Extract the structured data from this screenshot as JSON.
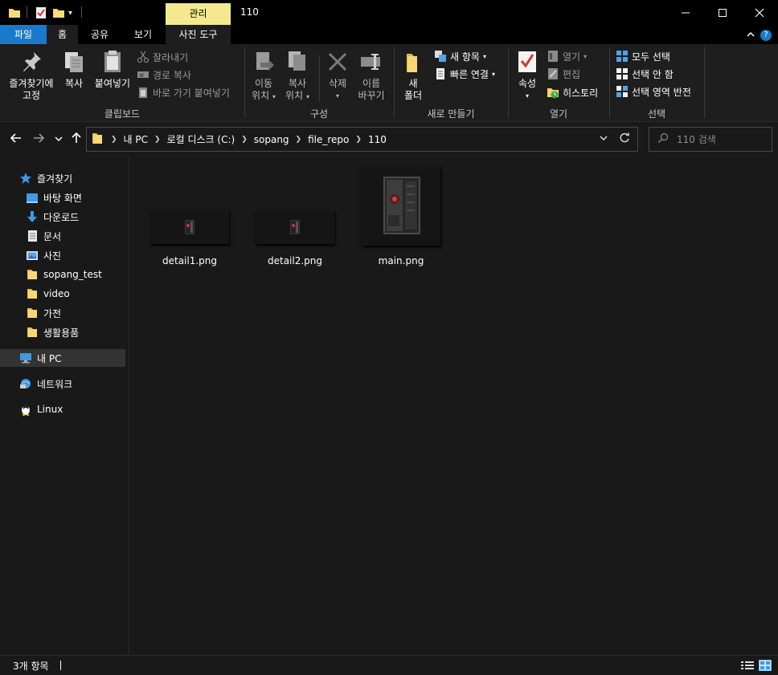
{
  "titlebar": {
    "manage_tab": "관리",
    "title": "110",
    "minimize_icon": "minimize-icon",
    "maximize_icon": "maximize-icon",
    "close_icon": "close-icon"
  },
  "ribbon_tabs": {
    "file": "파일",
    "home": "홈",
    "share": "공유",
    "view": "보기",
    "picture_tools": "사진 도구",
    "help": "?"
  },
  "ribbon": {
    "clipboard": {
      "label": "클립보드",
      "pin_line1": "즐겨찾기에",
      "pin_line2": "고정",
      "copy": "복사",
      "paste": "붙여넣기",
      "cut": "잘라내기",
      "copy_path": "경로 복사",
      "paste_shortcut": "바로 가기 붙여넣기"
    },
    "organize": {
      "label": "구성",
      "move_line1": "이동",
      "move_line2": "위치",
      "copy_to_line1": "복사",
      "copy_to_line2": "위치",
      "delete": "삭제",
      "rename_line1": "이름",
      "rename_line2": "바꾸기"
    },
    "new": {
      "label": "새로 만들기",
      "new_folder_line1": "새",
      "new_folder_line2": "폴더",
      "new_item": "새 항목",
      "easy_access": "빠른 연결"
    },
    "open": {
      "label": "열기",
      "properties": "속성",
      "open": "열기",
      "edit": "편집",
      "history": "히스토리"
    },
    "select": {
      "label": "선택",
      "select_all": "모두 선택",
      "select_none": "선택 안 함",
      "invert_selection": "선택 영역 반전"
    }
  },
  "address": {
    "crumbs": [
      "내 PC",
      "로컬 디스크 (C:)",
      "sopang",
      "file_repo",
      "110"
    ],
    "search_placeholder": "110 검색"
  },
  "nav_pane": {
    "quick_access": "즐겨찾기",
    "items": [
      {
        "label": "바탕 화면",
        "pinned": true
      },
      {
        "label": "다운로드",
        "pinned": true
      },
      {
        "label": "문서",
        "pinned": true
      },
      {
        "label": "사진",
        "pinned": true
      },
      {
        "label": "sopang_test",
        "pinned": false
      },
      {
        "label": "video",
        "pinned": false
      },
      {
        "label": "가전",
        "pinned": false
      },
      {
        "label": "생활용품",
        "pinned": false
      }
    ],
    "this_pc": "내 PC",
    "network": "네트워크",
    "linux": "Linux"
  },
  "files": [
    {
      "name": "detail1.png"
    },
    {
      "name": "detail2.png"
    },
    {
      "name": "main.png"
    }
  ],
  "status": {
    "count_text": "3개 항목"
  },
  "colors": {
    "accent": "#1979ca",
    "manage_tab": "#f5e98f",
    "folder": "#f4d26a",
    "background": "#191919"
  }
}
